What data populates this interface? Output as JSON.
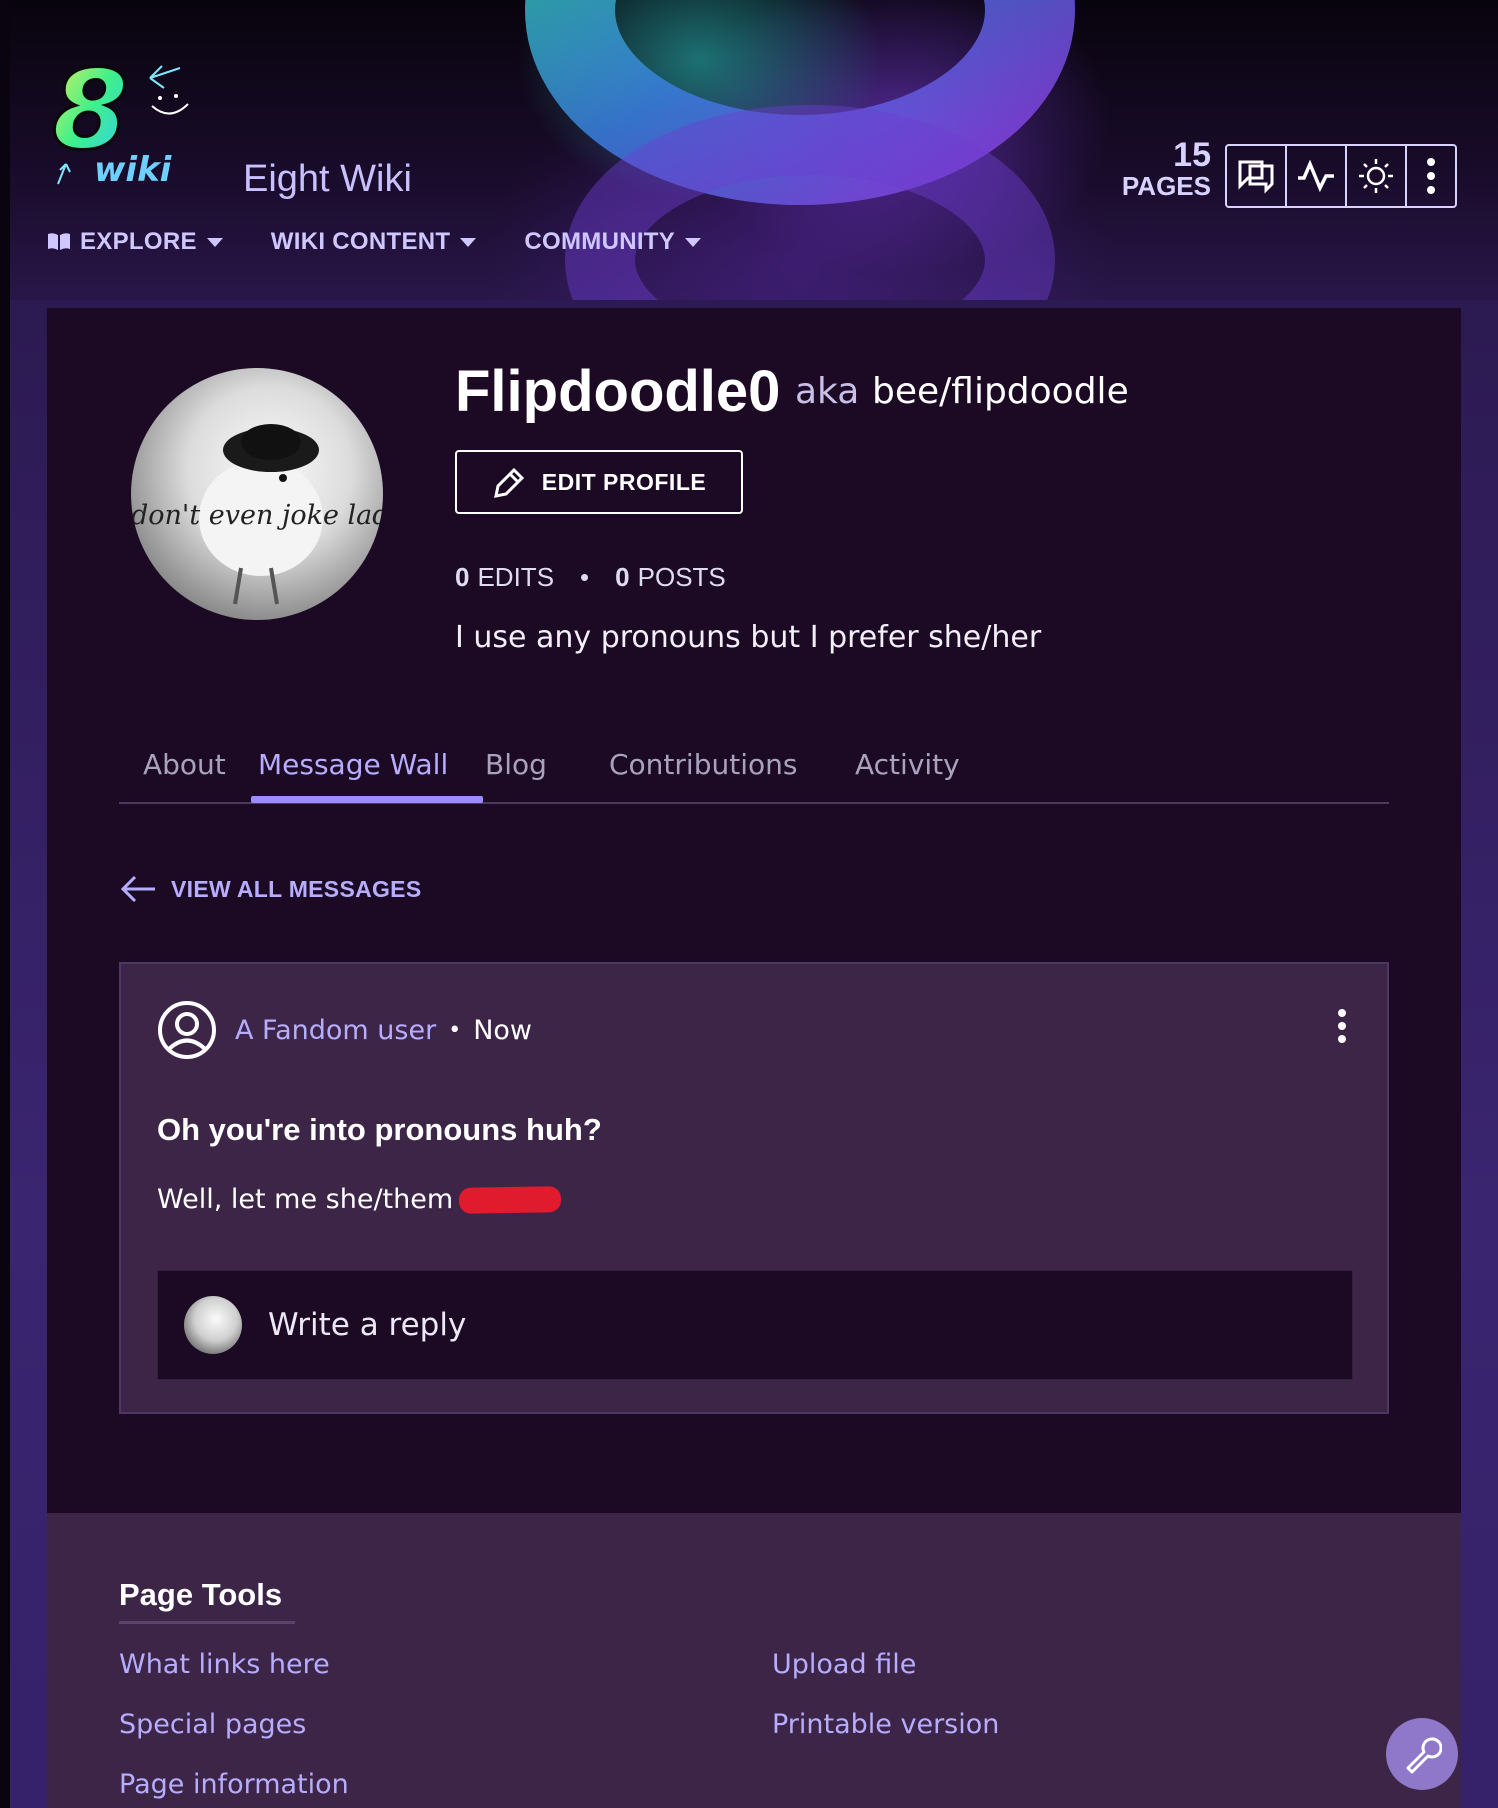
{
  "site": {
    "name": "Eight Wiki",
    "logo_text": "8 Wiki",
    "pages_count": "15",
    "pages_label": "PAGES"
  },
  "header_tools": [
    "discussions-icon",
    "activity-icon",
    "theme-icon",
    "more-icon"
  ],
  "nav": [
    {
      "label": "EXPLORE",
      "icon": "book-icon"
    },
    {
      "label": "WIKI CONTENT"
    },
    {
      "label": "COMMUNITY"
    }
  ],
  "profile": {
    "username": "Flipdoodle0",
    "aka_label": "aka",
    "aka_value": "bee/flipdoodle",
    "avatar_caption": "don't even joke lad.",
    "edit_label": "EDIT PROFILE",
    "edits_count": "0",
    "edits_label": "EDITS",
    "posts_count": "0",
    "posts_label": "POSTS",
    "bio": "I use any pronouns but I prefer she/her"
  },
  "tabs": [
    {
      "label": "About",
      "active": false
    },
    {
      "label": "Message Wall",
      "active": true
    },
    {
      "label": "Blog",
      "active": false
    },
    {
      "label": "Contributions",
      "active": false
    },
    {
      "label": "Activity",
      "active": false
    }
  ],
  "view_all_label": "VIEW ALL MESSAGES",
  "message": {
    "author": "A Fandom user",
    "time": "Now",
    "title": "Oh you're into pronouns huh?",
    "body": "Well, let me she/them",
    "reply_placeholder": "Write a reply"
  },
  "footer": {
    "title": "Page Tools",
    "links_left": [
      "What links here",
      "Special pages",
      "Page information"
    ],
    "links_right": [
      "Upload file",
      "Printable version"
    ]
  },
  "colors": {
    "accent": "#b7adff",
    "background": "#1c0a24",
    "card": "#3d2548",
    "redaction": "#e01b2e"
  }
}
